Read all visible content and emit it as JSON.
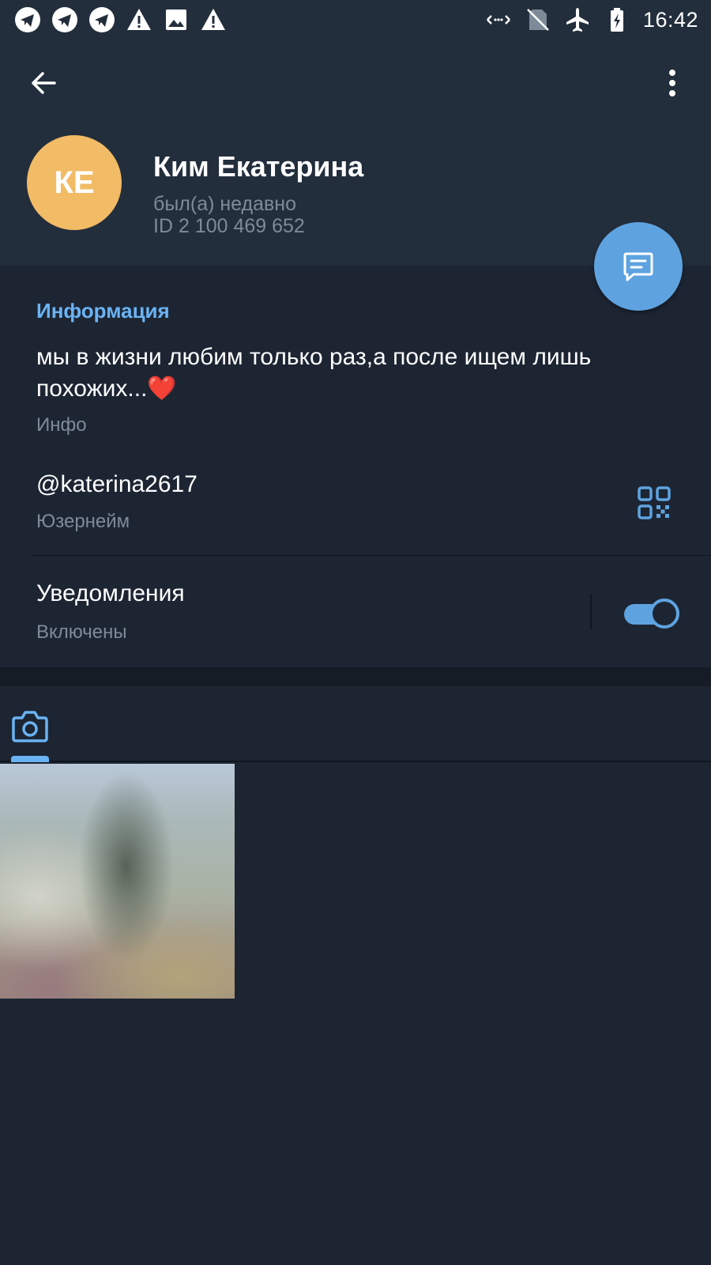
{
  "status_bar": {
    "time": "16:42",
    "left_icons": [
      "telegram-notification-icon",
      "telegram-notification-icon",
      "telegram-notification-icon",
      "warning-icon",
      "image-icon",
      "warning-icon"
    ],
    "right_icons": [
      "data-arrows-icon",
      "no-sim-icon",
      "airplane-mode-icon",
      "battery-charging-icon"
    ]
  },
  "toolbar": {
    "back_icon": "arrow-left-icon",
    "menu_icon": "more-vertical-icon"
  },
  "profile": {
    "initials": "КЕ",
    "avatar_color": "#f2bb65",
    "name": "Ким Екатерина",
    "last_seen": "был(а) недавно",
    "user_id": "ID 2 100 469 652"
  },
  "fab": {
    "icon": "message-icon",
    "color": "#5ea3e0"
  },
  "info": {
    "section_title": "Информация",
    "bio": "мы в жизни любим только раз,а после ищем лишь похожих...❤️",
    "bio_label": "Инфо",
    "username": "@katerina2617",
    "username_label": "Юзернейм",
    "qr_icon": "qr-code-icon",
    "notifications_title": "Уведомления",
    "notifications_state": "Включены",
    "notifications_enabled": true
  },
  "media_tabs": {
    "active_tab_icon": "camera-icon",
    "accent_color": "#6ab3f3"
  },
  "media": {
    "photo_count": 1
  }
}
